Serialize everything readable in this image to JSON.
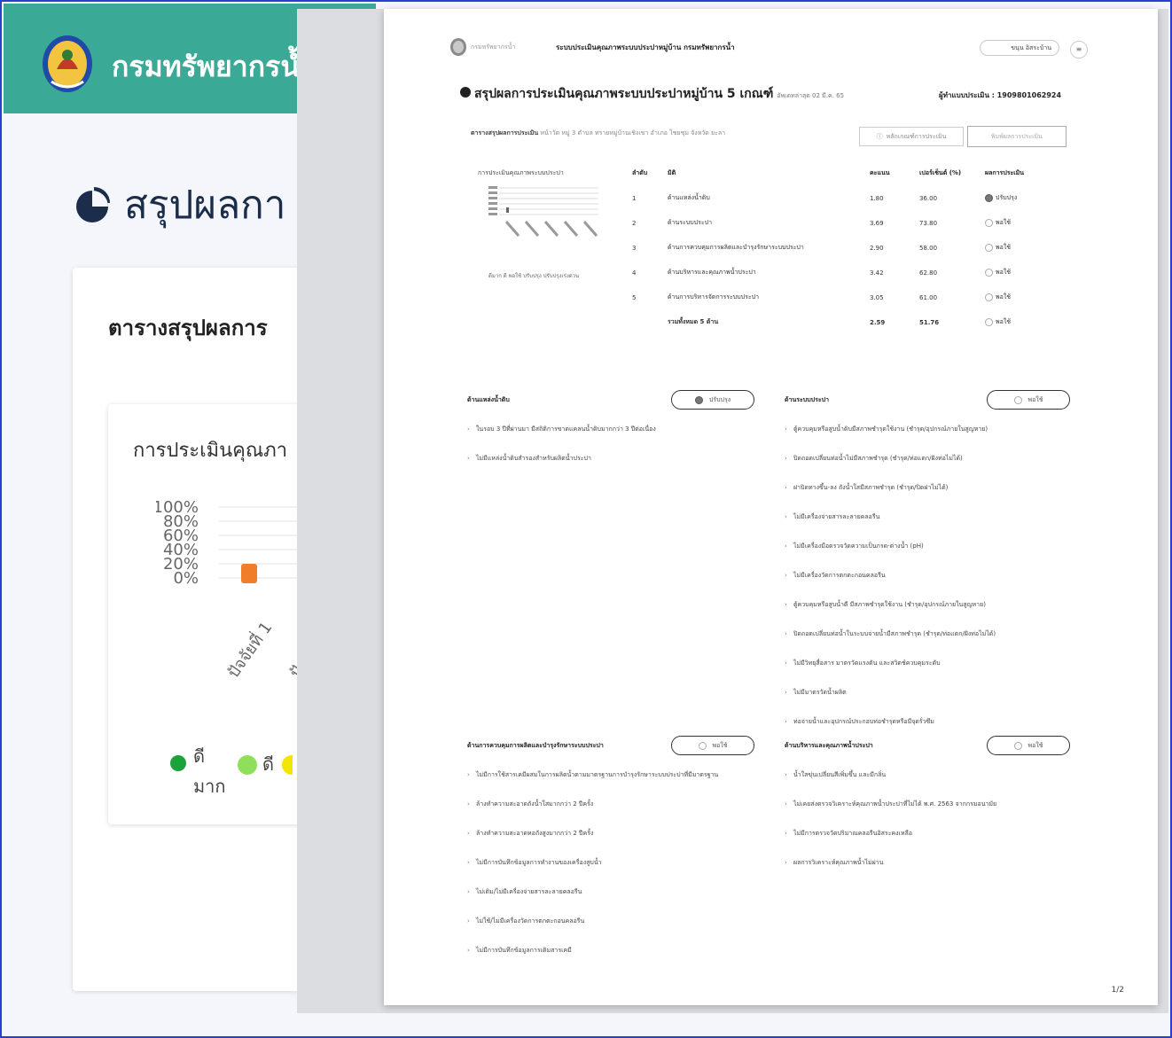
{
  "bg": {
    "header_title": "กรมทรัพยากรน้ำ",
    "page_heading": "สรุปผลกา",
    "card_title": "ตารางสรุปผลการ",
    "chart_title": "การประเมินคุณภา",
    "chart_ticks": [
      "100%",
      "80%",
      "60%",
      "40%",
      "20%",
      "0%"
    ],
    "chart_categories": [
      "ปัจจัยที่ 1",
      "ปัจจัยที่"
    ],
    "legend": [
      {
        "label": "ดี\nมาก",
        "color": "#1aa33b"
      },
      {
        "label": "ดี",
        "color": "#8ee05a"
      }
    ]
  },
  "doc": {
    "agency": "กรมทรัพยากรน้ำ",
    "system_title": "ระบบประเมินคุณภาพระบบประปาหมู่บ้าน กรมทรัพยากรน้ำ",
    "user_button": "ขนุน อิสระบ้าน",
    "heading": "สรุปผลการประเมินคุณภาพระบบประปาหมู่บ้าน 5 เกณฑ์",
    "heading_date": "อัพเดทล่าสุด 02 มี.ค. 65",
    "assessor": "ผู้ทำแบบประเมิน : 1909801062924",
    "table_caption_bold": "ตารางสรุปผลการประเมิน",
    "table_caption": "หน้าวัด หมู่ 3 ตำบล ทรายหมู่บ้านเชิงเขา อำเภอ ไชยชุม จังหวัด ยะลา",
    "btn_history": "หลักเกณฑ์การประเมิน",
    "btn_print": "พิมพ์ผลการประเมิน",
    "mini_chart_title": "การประเมินคุณภาพระบบประปา",
    "mini_legend": "ดีมาก  ดี  พอใช้  ปรับปรุง  ปรับปรุงเร่งด่วน",
    "table_headers": [
      "ลำดับ",
      "มิติ",
      "คะแนน",
      "เปอร์เซ็นต์ (%)",
      "ผลการประเมิน"
    ],
    "rows": [
      {
        "no": "1",
        "name": "ด้านแหล่งน้ำดิบ",
        "score": "1.80",
        "pct": "36.00",
        "result": "ปรับปรุง",
        "pass": true
      },
      {
        "no": "2",
        "name": "ด้านระบบประปา",
        "score": "3.69",
        "pct": "73.80",
        "result": "พอใช้",
        "pass": false
      },
      {
        "no": "3",
        "name": "ด้านการควบคุมการผลิตและบำรุงรักษาระบบประปา",
        "score": "2.90",
        "pct": "58.00",
        "result": "พอใช้",
        "pass": false
      },
      {
        "no": "4",
        "name": "ด้านบริหารและคุณภาพน้ำประปา",
        "score": "3.42",
        "pct": "62.80",
        "result": "พอใช้",
        "pass": false
      },
      {
        "no": "5",
        "name": "ด้านการบริหารจัดการระบบประปา",
        "score": "3.05",
        "pct": "61.00",
        "result": "พอใช้",
        "pass": false
      }
    ],
    "total": {
      "name": "รวมทั้งหมด 5 ด้าน",
      "score": "2.59",
      "pct": "51.76",
      "result": "พอใช้"
    },
    "sections": [
      {
        "title": "ด้านแหล่งน้ำดิบ",
        "status": "ปรับปรุง",
        "items": [
          "ในรอบ 3 ปีที่ผ่านมา มีสถิติการขาดแคลนน้ำดิบมากกว่า 3 ปีต่อเนื่อง",
          "ไม่มีแหล่งน้ำดิบสำรองสำหรับผลิตน้ำประปา"
        ]
      },
      {
        "title": "ด้านระบบประปา",
        "status": "พอใช้",
        "items": [
          "ตู้ควบคุมหรือสูบน้ำดิบมีสภาพชำรุดใช้งาน (ชำรุด/อุปกรณ์ภายในสูญหาย)",
          "ปิดถอดเปลี่ยนท่อน้ำไม่มีสภาพชำรุด (ชำรุด/ท่อแตก/ฝังท่อไม่ได้)",
          "ฝาปิดทางขึ้น-ลง ถังน้ำใสมีสภาพชำรุด (ชำรุด/ปิดฝาไม่ได้)",
          "ไม่มีเครื่องจ่ายสารละลายคลอรีน",
          "ไม่มีเครื่องมือตรวจวัดความเป็นกรด-ด่างน้ำ (pH)",
          "ไม่มีเครื่องวัดการตกตะกอนคลอรีน",
          "ตู้ควบคุมหรือสูบน้ำดี มีสภาพชำรุดใช้งาน (ชำรุด/อุปกรณ์ภายในสูญหาย)",
          "ปิดถอดเปลี่ยนท่อน้ำในระบบจ่ายน้ำมีสภาพชำรุด (ชำรุด/ท่อแตก/ฝังท่อไม่ได้)",
          "ไม่มีวิทยุสื่อสาร มาตรวัดแรงดัน และสวิตช์ควบคุมระดับ",
          "ไม่มีมาตรวัดน้ำผลิต",
          "ท่อจ่ายน้ำและอุปกรณ์ประกอบท่อชำรุดหรือมีจุดรั่วซึม"
        ]
      },
      {
        "title": "ด้านการควบคุมการผลิตและบำรุงรักษาระบบประปา",
        "status": "พอใช้",
        "items": [
          "ไม่มีการใช้สารเคมีผสมในการผลิตน้ำตามมาตรฐานการบำรุงรักษาระบบประปาที่มีมาตรฐาน",
          "ล้างทำความสะอาดถังน้ำใสมากกว่า 2 ปีครั้ง",
          "ล้างทำความสะอาดหอถังสูงมากกว่า 2 ปีครั้ง",
          "ไม่มีการบันทึกข้อมูลการทำงานของเครื่องสูบน้ำ",
          "ไม่เติม/ไม่มีเครื่องจ่ายสารละลายคลอรีน",
          "ไม่ใช้/ไม่มีเครื่องวัดการตกตะกอนคลอรีน",
          "ไม่มีการบันทึกข้อมูลการเติมสารเคมี"
        ]
      },
      {
        "title": "ด้านบริหารและคุณภาพน้ำประปา",
        "status": "พอใช้",
        "items": [
          "น้ำใสขุ่นเปลี่ยนสีเพิ่มขึ้น และมีกลิ่น",
          "ไม่เคยส่งตรวจวิเคราะห์คุณภาพน้ำประปาที่ไม่ได้ พ.ศ. 2563 จากกรมอนามัย",
          "ไม่มีการตรวจวัดปริมาณคลอรีนอิสระคงเหลือ",
          "ผลการวิเคราะห์คุณภาพน้ำไม่ผ่าน"
        ]
      }
    ],
    "page_number": "1/2"
  }
}
